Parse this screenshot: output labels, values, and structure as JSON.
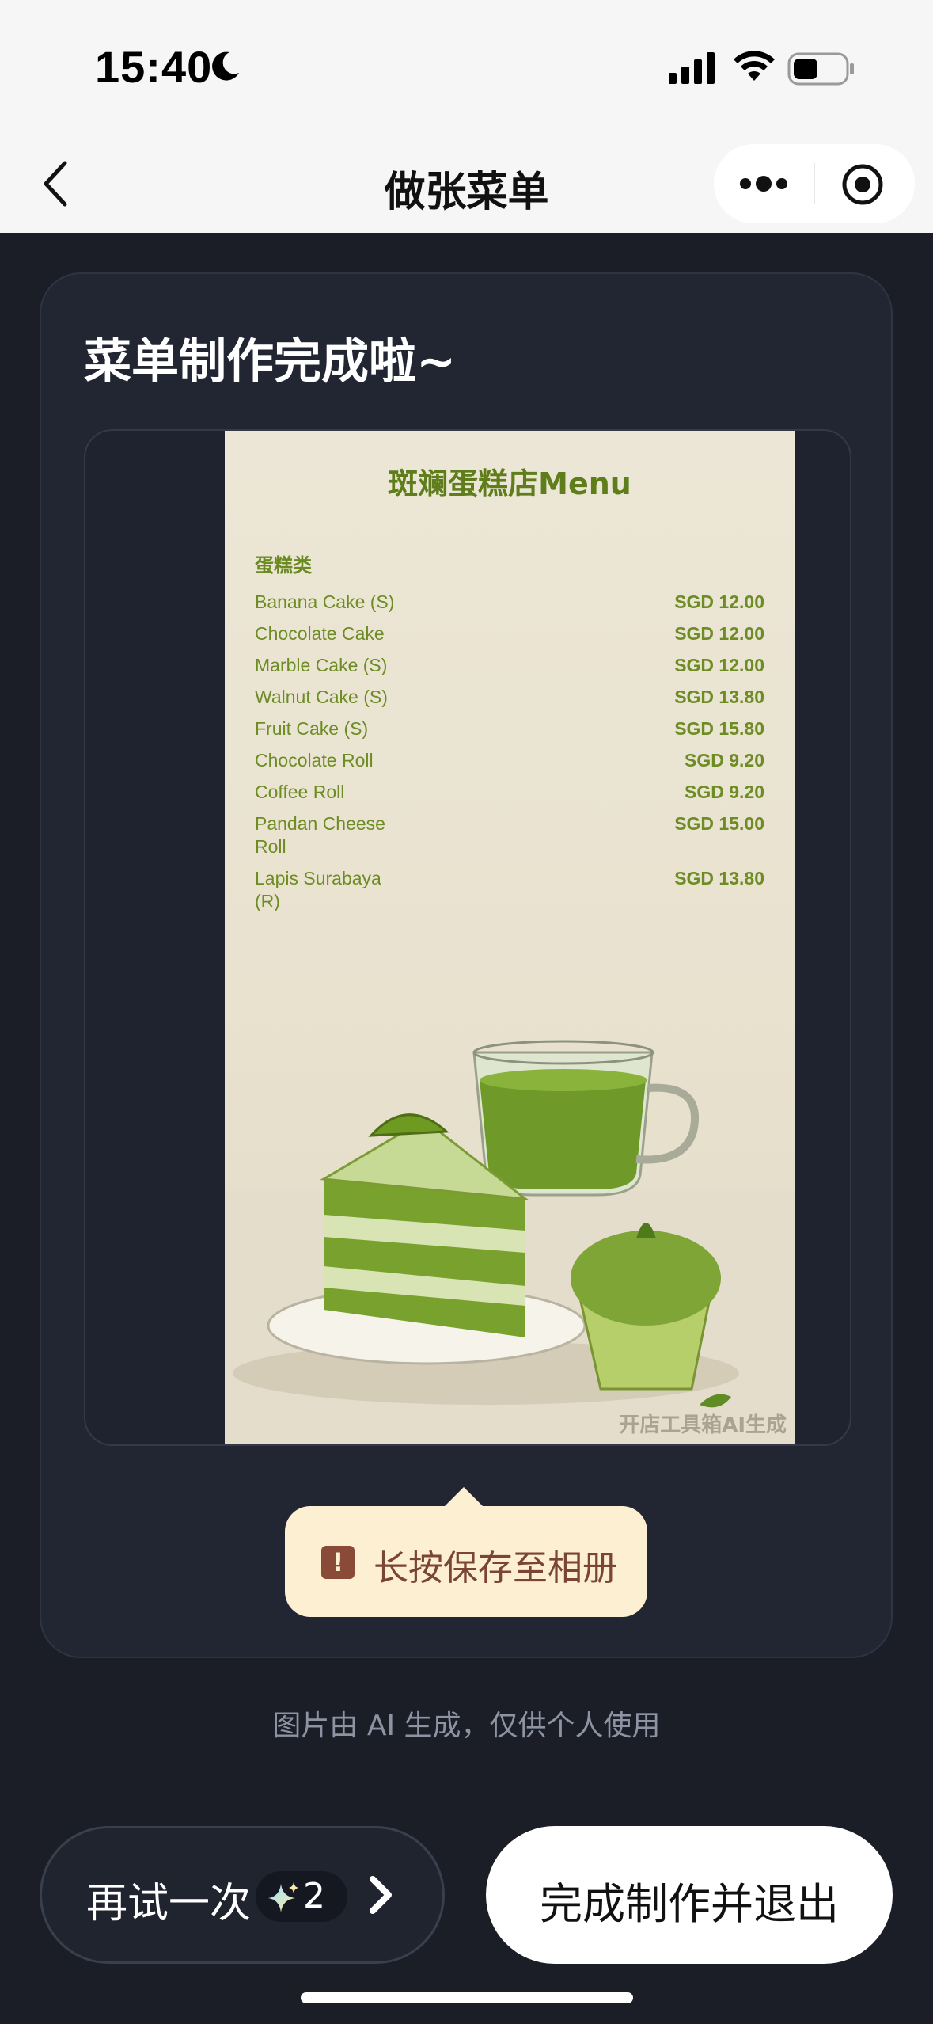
{
  "status_bar": {
    "time": "15:40"
  },
  "nav": {
    "title": "做张菜单"
  },
  "card": {
    "title": "菜单制作完成啦~"
  },
  "menu": {
    "title": "斑斓蛋糕店Menu",
    "category": "蛋糕类",
    "items": [
      {
        "name": "Banana Cake (S)",
        "price": "SGD 12.00"
      },
      {
        "name": "Chocolate Cake",
        "price": "SGD 12.00"
      },
      {
        "name": "Marble Cake (S)",
        "price": "SGD 12.00"
      },
      {
        "name": "Walnut Cake (S)",
        "price": "SGD 13.80"
      },
      {
        "name": "Fruit Cake (S)",
        "price": "SGD 15.80"
      },
      {
        "name": "Chocolate Roll",
        "price": "SGD 9.20"
      },
      {
        "name": "Coffee Roll",
        "price": "SGD 9.20"
      },
      {
        "name": "Pandan Cheese Roll",
        "price": "SGD 15.00"
      },
      {
        "name": "Lapis Surabaya (R)",
        "price": "SGD 13.80"
      }
    ],
    "watermark": "开店工具箱AI生成"
  },
  "tooltip": {
    "text": "长按保存至相册",
    "icon": "alert-icon"
  },
  "disclaimer": "图片由 AI 生成，仅供个人使用",
  "buttons": {
    "retry_label": "再试一次",
    "retry_count": "2",
    "finish_label": "完成制作并退出"
  },
  "colors": {
    "background": "#1b1e27",
    "card": "#222633",
    "menu_text": "#6e8c24",
    "tooltip_bg": "#fdf0d2",
    "tooltip_text": "#7a4535"
  }
}
